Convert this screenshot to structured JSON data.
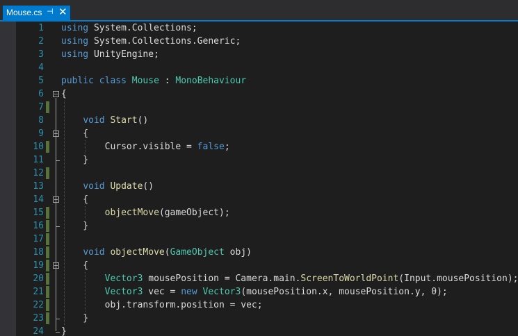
{
  "tab": {
    "title": "Mouse.cs",
    "pin": "⊣",
    "close": "✕"
  },
  "lines": [
    {
      "num": "1",
      "tokens": [
        {
          "t": "kw",
          "s": "using"
        },
        {
          "t": "tx",
          "s": " System.Collections;"
        }
      ],
      "change": false,
      "fold": false
    },
    {
      "num": "2",
      "tokens": [
        {
          "t": "kw",
          "s": "using"
        },
        {
          "t": "tx",
          "s": " System.Collections.Generic;"
        }
      ],
      "change": false,
      "fold": false
    },
    {
      "num": "3",
      "tokens": [
        {
          "t": "kw",
          "s": "using"
        },
        {
          "t": "tx",
          "s": " UnityEngine;"
        }
      ],
      "change": false,
      "fold": false
    },
    {
      "num": "4",
      "tokens": [],
      "change": false,
      "fold": false
    },
    {
      "num": "5",
      "tokens": [
        {
          "t": "kw",
          "s": "public"
        },
        {
          "t": "tx",
          "s": " "
        },
        {
          "t": "kw",
          "s": "class"
        },
        {
          "t": "tx",
          "s": " "
        },
        {
          "t": "ty",
          "s": "Mouse"
        },
        {
          "t": "tx",
          "s": " : "
        },
        {
          "t": "ty",
          "s": "MonoBehaviour"
        }
      ],
      "change": false,
      "fold": false
    },
    {
      "num": "6",
      "tokens": [
        {
          "t": "tx",
          "s": "{"
        }
      ],
      "change": false,
      "fold": true
    },
    {
      "num": "7",
      "tokens": [],
      "change": true,
      "fold": false
    },
    {
      "num": "8",
      "tokens": [
        {
          "t": "tx",
          "s": "    "
        },
        {
          "t": "kw",
          "s": "void"
        },
        {
          "t": "tx",
          "s": " "
        },
        {
          "t": "mt",
          "s": "Start"
        },
        {
          "t": "tx",
          "s": "()"
        }
      ],
      "change": false,
      "fold": false
    },
    {
      "num": "9",
      "tokens": [
        {
          "t": "tx",
          "s": "    {"
        }
      ],
      "change": false,
      "fold": true
    },
    {
      "num": "10",
      "tokens": [
        {
          "t": "tx",
          "s": "        Cursor.visible = "
        },
        {
          "t": "kw",
          "s": "false"
        },
        {
          "t": "tx",
          "s": ";"
        }
      ],
      "change": true,
      "fold": false
    },
    {
      "num": "11",
      "tokens": [
        {
          "t": "tx",
          "s": "    }"
        }
      ],
      "change": false,
      "fold": false
    },
    {
      "num": "12",
      "tokens": [],
      "change": true,
      "fold": false
    },
    {
      "num": "13",
      "tokens": [
        {
          "t": "tx",
          "s": "    "
        },
        {
          "t": "kw",
          "s": "void"
        },
        {
          "t": "tx",
          "s": " "
        },
        {
          "t": "mt",
          "s": "Update"
        },
        {
          "t": "tx",
          "s": "()"
        }
      ],
      "change": false,
      "fold": false
    },
    {
      "num": "14",
      "tokens": [
        {
          "t": "tx",
          "s": "    {"
        }
      ],
      "change": false,
      "fold": true
    },
    {
      "num": "15",
      "tokens": [
        {
          "t": "tx",
          "s": "        "
        },
        {
          "t": "mt",
          "s": "objectMove"
        },
        {
          "t": "tx",
          "s": "(gameObject);"
        }
      ],
      "change": true,
      "fold": false
    },
    {
      "num": "16",
      "tokens": [
        {
          "t": "tx",
          "s": "    }"
        }
      ],
      "change": true,
      "fold": false
    },
    {
      "num": "17",
      "tokens": [],
      "change": true,
      "fold": false
    },
    {
      "num": "18",
      "tokens": [
        {
          "t": "tx",
          "s": "    "
        },
        {
          "t": "kw",
          "s": "void"
        },
        {
          "t": "tx",
          "s": " "
        },
        {
          "t": "mt",
          "s": "objectMove"
        },
        {
          "t": "tx",
          "s": "("
        },
        {
          "t": "ty",
          "s": "GameObject"
        },
        {
          "t": "tx",
          "s": " obj)"
        }
      ],
      "change": true,
      "fold": false
    },
    {
      "num": "19",
      "tokens": [
        {
          "t": "tx",
          "s": "    {"
        }
      ],
      "change": true,
      "fold": true
    },
    {
      "num": "20",
      "tokens": [
        {
          "t": "tx",
          "s": "        "
        },
        {
          "t": "ty",
          "s": "Vector3"
        },
        {
          "t": "tx",
          "s": " mousePosition = Camera.main."
        },
        {
          "t": "mt",
          "s": "ScreenToWorldPoint"
        },
        {
          "t": "tx",
          "s": "(Input.mousePosition);"
        }
      ],
      "change": true,
      "fold": false
    },
    {
      "num": "21",
      "tokens": [
        {
          "t": "tx",
          "s": "        "
        },
        {
          "t": "ty",
          "s": "Vector3"
        },
        {
          "t": "tx",
          "s": " vec = "
        },
        {
          "t": "kw",
          "s": "new"
        },
        {
          "t": "tx",
          "s": " "
        },
        {
          "t": "ty",
          "s": "Vector3"
        },
        {
          "t": "tx",
          "s": "(mousePosition.x, mousePosition.y, 0);"
        }
      ],
      "change": true,
      "fold": false
    },
    {
      "num": "22",
      "tokens": [
        {
          "t": "tx",
          "s": "        obj.transform.position = vec;"
        }
      ],
      "change": true,
      "fold": false
    },
    {
      "num": "23",
      "tokens": [
        {
          "t": "tx",
          "s": "    }"
        }
      ],
      "change": true,
      "fold": false
    },
    {
      "num": "24",
      "tokens": [
        {
          "t": "tx",
          "s": "}"
        }
      ],
      "change": false,
      "fold": false
    }
  ],
  "colors": {
    "keyword": "#569cd6",
    "type": "#4ec9b0",
    "text": "#dcdcdc",
    "method": "#dcdcaa",
    "line_number": "#2b91af",
    "change_marker": "#57733b",
    "tab_active": "#007acc"
  }
}
